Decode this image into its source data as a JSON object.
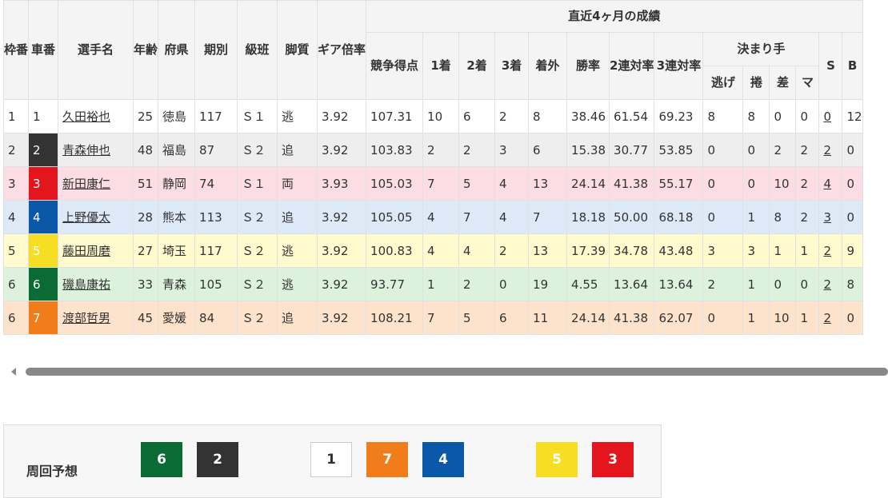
{
  "table": {
    "headers": {
      "waku": "枠番",
      "car": "車番",
      "name": "選手名",
      "age": "年齢",
      "pref": "府県",
      "term": "期別",
      "class": "級班",
      "style": "脚質",
      "gear": "ギア倍率",
      "recent": "直近4ヶ月の成績",
      "score": "競争得点",
      "first": "1着",
      "second": "2着",
      "third": "3着",
      "out": "着外",
      "win_rate": "勝率",
      "rate2": "2連対率",
      "rate3": "3連対率",
      "kimarite": "決まり手",
      "nige": "逃げ",
      "makuri": "捲",
      "sashi": "差",
      "ma": "マ",
      "s": "S",
      "b": "B"
    },
    "rows": [
      {
        "waku": "1",
        "car": "1",
        "name": "久田裕也",
        "age": "25",
        "pref": "徳島",
        "term": "117",
        "class": "Ｓ１",
        "style": "逃",
        "gear": "3.92",
        "score": "107.31",
        "first": "10",
        "second": "6",
        "third": "2",
        "out": "8",
        "win_rate": "38.46",
        "rate2": "61.54",
        "rate3": "69.23",
        "nige": "8",
        "makuri": "8",
        "sashi": "0",
        "ma": "0",
        "s": "0",
        "b": "12",
        "bg": "#ffffff",
        "car_bg": "#ffffff",
        "car_fg": "#333333"
      },
      {
        "waku": "2",
        "car": "2",
        "name": "青森伸也",
        "age": "48",
        "pref": "福島",
        "term": "87",
        "class": "Ｓ２",
        "style": "追",
        "gear": "3.92",
        "score": "103.83",
        "first": "2",
        "second": "2",
        "third": "3",
        "out": "6",
        "win_rate": "15.38",
        "rate2": "30.77",
        "rate3": "53.85",
        "nige": "0",
        "makuri": "0",
        "sashi": "2",
        "ma": "2",
        "s": "2",
        "b": "0",
        "bg": "#eeeeee",
        "car_bg": "#333333",
        "car_fg": "#ffffff"
      },
      {
        "waku": "3",
        "car": "3",
        "name": "新田康仁",
        "age": "51",
        "pref": "静岡",
        "term": "74",
        "class": "Ｓ１",
        "style": "両",
        "gear": "3.93",
        "score": "105.03",
        "first": "7",
        "second": "5",
        "third": "4",
        "out": "13",
        "win_rate": "24.14",
        "rate2": "41.38",
        "rate3": "55.17",
        "nige": "0",
        "makuri": "0",
        "sashi": "10",
        "ma": "2",
        "s": "4",
        "b": "0",
        "bg": "#fcdde3",
        "car_bg": "#e3161e",
        "car_fg": "#ffffff"
      },
      {
        "waku": "4",
        "car": "4",
        "name": "上野優太",
        "age": "28",
        "pref": "熊本",
        "term": "113",
        "class": "Ｓ２",
        "style": "追",
        "gear": "3.92",
        "score": "105.05",
        "first": "4",
        "second": "7",
        "third": "4",
        "out": "7",
        "win_rate": "18.18",
        "rate2": "50.00",
        "rate3": "68.18",
        "nige": "0",
        "makuri": "1",
        "sashi": "8",
        "ma": "2",
        "s": "3",
        "b": "0",
        "bg": "#dde9f7",
        "car_bg": "#0b58a8",
        "car_fg": "#ffffff"
      },
      {
        "waku": "5",
        "car": "5",
        "name": "藤田周磨",
        "age": "27",
        "pref": "埼玉",
        "term": "117",
        "class": "Ｓ２",
        "style": "逃",
        "gear": "3.92",
        "score": "100.83",
        "first": "4",
        "second": "4",
        "third": "2",
        "out": "13",
        "win_rate": "17.39",
        "rate2": "34.78",
        "rate3": "43.48",
        "nige": "3",
        "makuri": "3",
        "sashi": "1",
        "ma": "1",
        "s": "2",
        "b": "9",
        "bg": "#fffbcf",
        "car_bg": "#f6df22",
        "car_fg": "#ffffff"
      },
      {
        "waku": "6",
        "car": "6",
        "name": "磯島康祐",
        "age": "33",
        "pref": "青森",
        "term": "105",
        "class": "Ｓ２",
        "style": "逃",
        "gear": "3.92",
        "score": "93.77",
        "first": "1",
        "second": "2",
        "third": "0",
        "out": "19",
        "win_rate": "4.55",
        "rate2": "13.64",
        "rate3": "13.64",
        "nige": "2",
        "makuri": "1",
        "sashi": "0",
        "ma": "0",
        "s": "2",
        "b": "8",
        "bg": "#dcf2dd",
        "car_bg": "#0a6b34",
        "car_fg": "#ffffff"
      },
      {
        "waku": "6",
        "car": "7",
        "name": "渡部哲男",
        "age": "45",
        "pref": "愛媛",
        "term": "84",
        "class": "Ｓ２",
        "style": "追",
        "gear": "3.92",
        "score": "108.21",
        "first": "7",
        "second": "5",
        "third": "6",
        "out": "11",
        "win_rate": "24.14",
        "rate2": "41.38",
        "rate3": "62.07",
        "nige": "0",
        "makuri": "1",
        "sashi": "10",
        "ma": "1",
        "s": "2",
        "b": "0",
        "bg": "#fde3cc",
        "car_bg": "#f07d1a",
        "car_fg": "#ffffff"
      }
    ]
  },
  "forecast": {
    "label": "周回予想",
    "boxes": [
      {
        "num": "6",
        "bg": "#0a6b34",
        "fg": "#ffffff"
      },
      {
        "num": "2",
        "bg": "#333333",
        "fg": "#ffffff"
      },
      {
        "num": "1",
        "bg": "#ffffff",
        "fg": "#333333"
      },
      {
        "num": "7",
        "bg": "#f07d1a",
        "fg": "#ffffff"
      },
      {
        "num": "4",
        "bg": "#0b58a8",
        "fg": "#ffffff"
      },
      {
        "num": "5",
        "bg": "#f6df22",
        "fg": "#ffffff"
      },
      {
        "num": "3",
        "bg": "#e3161e",
        "fg": "#ffffff"
      }
    ]
  },
  "icons": {
    "scroll_left": "triangle-left-icon"
  }
}
